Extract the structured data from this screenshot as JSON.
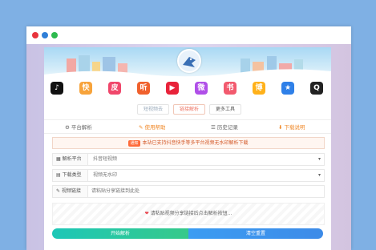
{
  "window": {
    "controls": [
      "close-dot",
      "minimize-dot",
      "maximize-dot"
    ],
    "colors": {
      "close": "#e8343c",
      "minimize": "#2f7fd8",
      "maximize": "#2dba4e"
    }
  },
  "banner": {
    "avatar_icon": "bird-avatar-icon"
  },
  "apps": [
    {
      "name": "tiktok-icon",
      "glyph": "♪",
      "color": "#111111"
    },
    {
      "name": "kuaishou-icon",
      "glyph": "快",
      "color": "#f7a33b"
    },
    {
      "name": "pipixia-icon",
      "glyph": "皮",
      "color": "#f0476b"
    },
    {
      "name": "huoshan-icon",
      "glyph": "听",
      "color": "#f0612d"
    },
    {
      "name": "youtube-icon",
      "glyph": "▶",
      "color": "#e8233a"
    },
    {
      "name": "weishi-icon",
      "glyph": "微",
      "color": "#b04fe8"
    },
    {
      "name": "xiaohongshu-icon",
      "glyph": "书",
      "color": "#f25a6e"
    },
    {
      "name": "weibo-icon",
      "glyph": "博",
      "color": "#ffb11a"
    },
    {
      "name": "star-icon",
      "glyph": "★",
      "color": "#2f80e8"
    },
    {
      "name": "qq-icon",
      "glyph": "Q",
      "color": "#222222"
    }
  ],
  "top_tabs": [
    "短视频去",
    "链接解析",
    "更多工具"
  ],
  "nav": [
    "平台解析",
    "使用帮助",
    "历史记录",
    "下载说明"
  ],
  "notice": {
    "tag": "通知",
    "text": "本站已支持抖音快手等多平台视频无水印解析下载"
  },
  "form": {
    "platform_label": "解析平台",
    "platform_value": "抖音短视频",
    "type_label": "下载类型",
    "type_value": "视频无水印",
    "url_label": "视频链接",
    "url_placeholder": "请粘贴分享链接到此处"
  },
  "info_text": "请粘贴视频分享链接后点击解析按钮...",
  "buttons": {
    "parse": "开始解析",
    "clear": "清空重置"
  }
}
